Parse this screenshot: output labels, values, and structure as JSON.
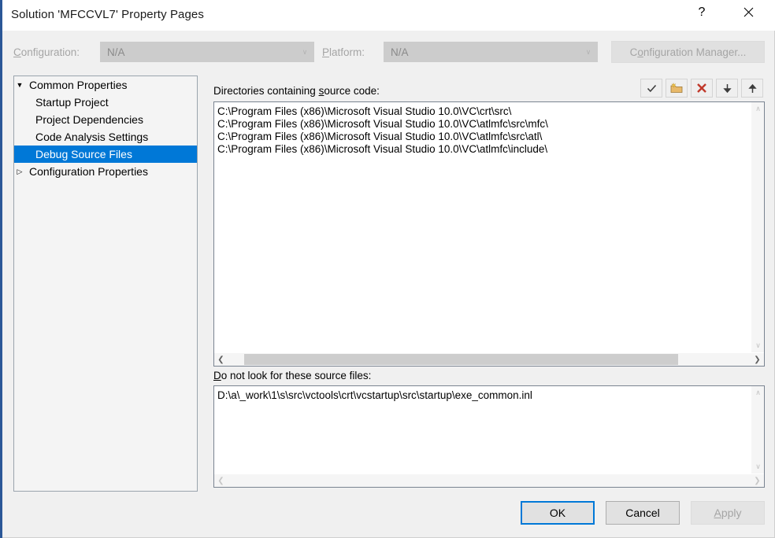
{
  "window": {
    "title": "Solution 'MFCCVL7' Property Pages",
    "help_glyph": "?",
    "close_glyph": "✕"
  },
  "config_bar": {
    "configuration_label": "Configuration:",
    "configuration_value": "N/A",
    "platform_label": "Platform:",
    "platform_value": "N/A",
    "configuration_manager_label": "Configuration Manager...",
    "chevron": "∨"
  },
  "tree": {
    "items": [
      {
        "label": "Common Properties",
        "level": 0,
        "twisty": "▼",
        "selected": false
      },
      {
        "label": "Startup Project",
        "level": 1,
        "twisty": "",
        "selected": false
      },
      {
        "label": "Project Dependencies",
        "level": 1,
        "twisty": "",
        "selected": false
      },
      {
        "label": "Code Analysis Settings",
        "level": 1,
        "twisty": "",
        "selected": false
      },
      {
        "label": "Debug Source Files",
        "level": 1,
        "twisty": "",
        "selected": true
      },
      {
        "label": "Configuration Properties",
        "level": 0,
        "twisty": "▷",
        "selected": false
      }
    ]
  },
  "toolbar": {
    "buttons": [
      {
        "name": "check-icon",
        "tooltip": "Check"
      },
      {
        "name": "new-folder-icon",
        "tooltip": "New Line"
      },
      {
        "name": "delete-x-icon",
        "tooltip": "Delete"
      },
      {
        "name": "arrow-down-icon",
        "tooltip": "Move Down"
      },
      {
        "name": "arrow-up-icon",
        "tooltip": "Move Up"
      }
    ]
  },
  "source_section": {
    "label_pre": "Directories containing ",
    "label_underline": "s",
    "label_post": "ource code:",
    "rows": [
      "C:\\Program Files (x86)\\Microsoft Visual Studio 10.0\\VC\\crt\\src\\",
      "C:\\Program Files (x86)\\Microsoft Visual Studio 10.0\\VC\\atlmfc\\src\\mfc\\",
      "C:\\Program Files (x86)\\Microsoft Visual Studio 10.0\\VC\\atlmfc\\src\\atl\\",
      "C:\\Program Files (x86)\\Microsoft Visual Studio 10.0\\VC\\atlmfc\\include\\"
    ],
    "hscroll": {
      "enabled": true,
      "thumb_left_pct": 3,
      "thumb_width_pct": 79
    }
  },
  "exclude_section": {
    "label_underline": "D",
    "label_post": "o not look for these source files:",
    "rows": [
      "D:\\a\\_work\\1\\s\\src\\vctools\\crt\\vcstartup\\src\\startup\\exe_common.inl"
    ],
    "hscroll": {
      "enabled": false
    }
  },
  "scroll_glyphs": {
    "up": "∧",
    "down": "∨",
    "left": "❮",
    "right": "❯"
  },
  "footer": {
    "ok_label": "OK",
    "cancel_label": "Cancel",
    "apply_underline": "A",
    "apply_rest": "pply"
  },
  "colors": {
    "accent": "#0078d7",
    "dialog_bg": "#f0f0f0",
    "titlebar_bg": "#ffffff",
    "delete_red": "#c0392b",
    "folder_gold": "#e8b96a"
  }
}
